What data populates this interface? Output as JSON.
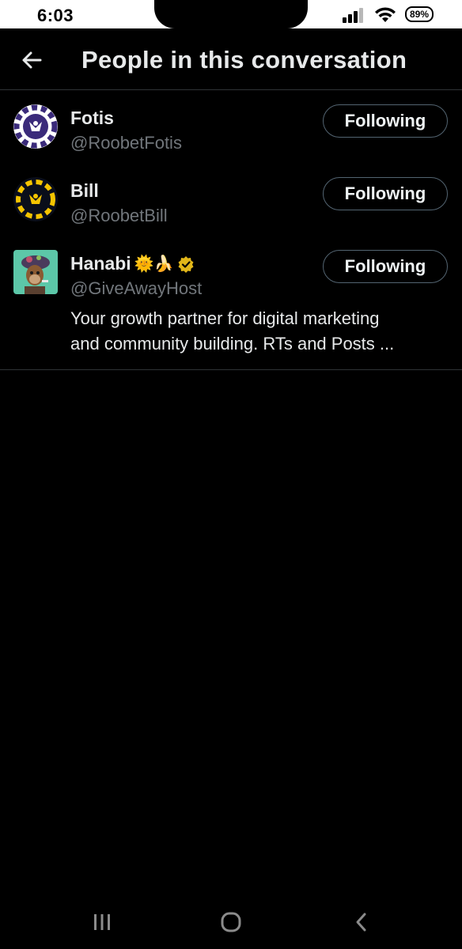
{
  "status_bar": {
    "time": "6:03",
    "battery": "89%",
    "icons": [
      "signal-icon",
      "wifi-icon",
      "battery-icon"
    ]
  },
  "header": {
    "title": "People in this conversation",
    "back_icon": "arrow-left-icon"
  },
  "users": [
    {
      "name": "Fotis",
      "handle": "@RoobetFotis",
      "button_label": "Following",
      "avatar_icon": "roobet-chip-purple-avatar"
    },
    {
      "name": "Bill",
      "handle": "@RoobetBill",
      "button_label": "Following",
      "avatar_icon": "roobet-chip-yellow-avatar"
    },
    {
      "name": "Hanabi",
      "name_emojis": "🌞🍌",
      "verified_icon": "verified-badge-icon",
      "handle": "@GiveAwayHost",
      "button_label": "Following",
      "bio_line1": "Your growth partner for digital marketing",
      "bio_line2": "and community building. RTs and Posts ...",
      "avatar_icon": "ape-nft-avatar"
    }
  ],
  "nav_bar": {
    "icons": [
      "recent-apps-icon",
      "home-icon",
      "back-icon"
    ]
  },
  "colors": {
    "background": "#000000",
    "text_primary": "#e7e9ea",
    "text_secondary": "#71767b",
    "border": "#2f3336",
    "verified_gold": "#e2b719"
  }
}
